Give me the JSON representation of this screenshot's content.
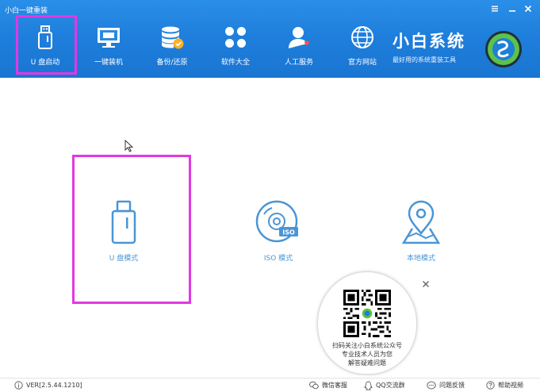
{
  "window": {
    "title": "小白一键重装",
    "controls": {
      "menu": "≡",
      "minimize": "—",
      "close": "✕"
    }
  },
  "nav": {
    "items": [
      {
        "label": "U 盘启动",
        "icon": "usb-drive-icon",
        "selected": true
      },
      {
        "label": "一键装机",
        "icon": "monitor-icon"
      },
      {
        "label": "备份/还原",
        "icon": "database-backup-icon"
      },
      {
        "label": "软件大全",
        "icon": "software-grid-icon"
      },
      {
        "label": "人工服务",
        "icon": "support-person-icon"
      },
      {
        "label": "官方网站",
        "icon": "globe-icon"
      }
    ]
  },
  "brand": {
    "name": "小白系统",
    "tagline": "最好用的系统重装工具"
  },
  "modes": [
    {
      "label": "U 盘模式",
      "icon": "usb-drive-icon"
    },
    {
      "label": "ISO 模式",
      "icon": "iso-disc-icon"
    },
    {
      "label": "本地模式",
      "icon": "location-pin-icon"
    }
  ],
  "qr_popup": {
    "close": "×",
    "line1": "扫码关注小白系统公众号",
    "line2": "专业技术人员为您",
    "line3": "解答疑难问题"
  },
  "status": {
    "version": "VER[2.5.44.1210]",
    "wechat": "微信客服",
    "qq": "QQ交流群",
    "feedback": "问题反馈",
    "help": "帮助视频"
  },
  "colors": {
    "header_blue": "#1f7fdc",
    "mode_blue": "#4a95d6",
    "highlight_magenta": "#e238e2"
  }
}
